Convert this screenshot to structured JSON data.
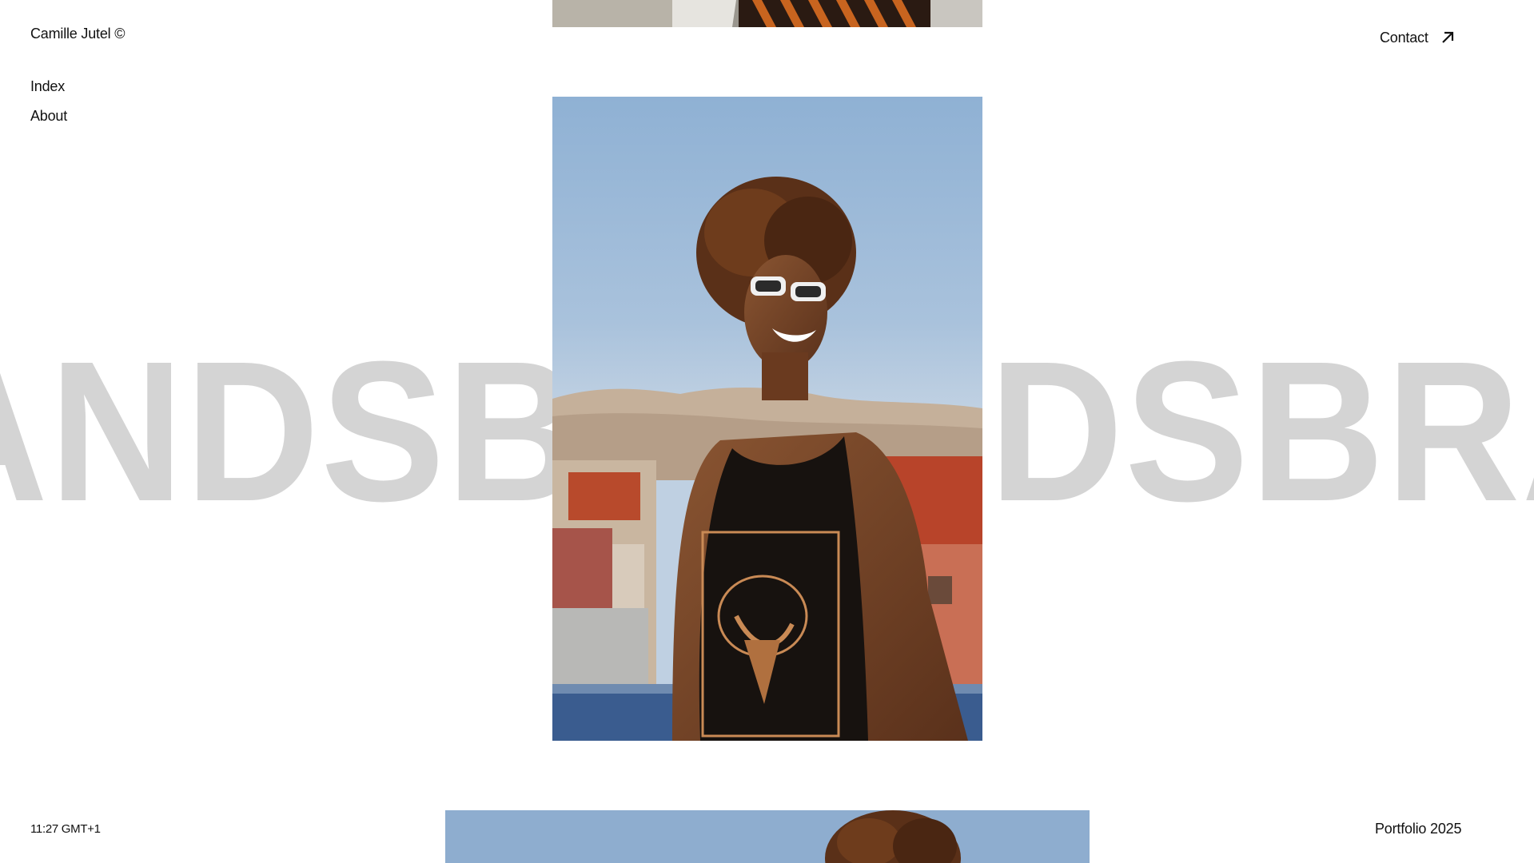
{
  "header": {
    "brand": "Camille Jutel ©",
    "contact_label": "Contact",
    "contact_icon": "arrow-up-right-icon"
  },
  "nav": {
    "items": [
      {
        "label": "Index"
      },
      {
        "label": "About"
      }
    ]
  },
  "marquee": {
    "text": "ANDSBRANDSBRANDSBRA"
  },
  "footer": {
    "clock": "11:27 GMT+1",
    "portfolio": "Portfolio 2025"
  },
  "colors": {
    "text": "#111111",
    "marquee": "#d4d4d4",
    "background": "#ffffff"
  }
}
